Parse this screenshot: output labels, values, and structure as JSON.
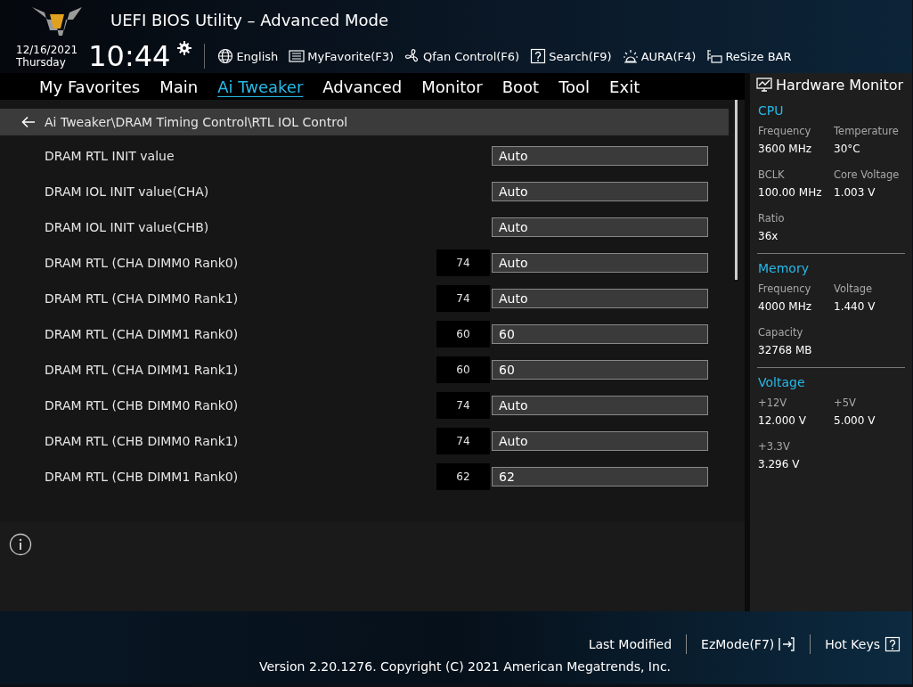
{
  "header": {
    "title": "UEFI BIOS Utility – Advanced Mode",
    "date": "12/16/2021",
    "day": "Thursday",
    "time": "10:44",
    "tools": [
      {
        "kind": "globe",
        "label": "English"
      },
      {
        "kind": "list",
        "label": "MyFavorite(F3)"
      },
      {
        "kind": "fan",
        "label": "Qfan Control(F6)"
      },
      {
        "kind": "question",
        "label": "Search(F9)"
      },
      {
        "kind": "light",
        "label": "AURA(F4)"
      },
      {
        "kind": "card",
        "label": "ReSize BAR"
      }
    ]
  },
  "tabs": [
    {
      "label": "My Favorites",
      "selected": false
    },
    {
      "label": "Main",
      "selected": false
    },
    {
      "label": "Ai Tweaker",
      "selected": true
    },
    {
      "label": "Advanced",
      "selected": false
    },
    {
      "label": "Monitor",
      "selected": false
    },
    {
      "label": "Boot",
      "selected": false
    },
    {
      "label": "Tool",
      "selected": false
    },
    {
      "label": "Exit",
      "selected": false
    }
  ],
  "breadcrumb": "Ai Tweaker\\DRAM Timing Control\\RTL IOL Control",
  "settings": [
    {
      "label": "DRAM RTL INIT value",
      "value": "Auto"
    },
    {
      "label": "DRAM IOL INIT value(CHA)",
      "value": "Auto"
    },
    {
      "label": "DRAM IOL INIT value(CHB)",
      "value": "Auto"
    },
    {
      "label": "DRAM RTL (CHA DIMM0 Rank0)",
      "current": "74",
      "value": "Auto"
    },
    {
      "label": "DRAM RTL (CHA DIMM0 Rank1)",
      "current": "74",
      "value": "Auto"
    },
    {
      "label": "DRAM RTL (CHA DIMM1 Rank0)",
      "current": "60",
      "value": "60"
    },
    {
      "label": "DRAM RTL (CHA DIMM1 Rank1)",
      "current": "60",
      "value": "60"
    },
    {
      "label": "DRAM RTL (CHB DIMM0 Rank0)",
      "current": "74",
      "value": "Auto"
    },
    {
      "label": "DRAM RTL (CHB DIMM0 Rank1)",
      "current": "74",
      "value": "Auto"
    },
    {
      "label": "DRAM RTL (CHB DIMM1 Rank0)",
      "current": "62",
      "value": "62"
    }
  ],
  "hardware_monitor": {
    "title": "Hardware Monitor",
    "sections": [
      {
        "title": "CPU",
        "items": [
          {
            "label": "Frequency",
            "value": "3600 MHz"
          },
          {
            "label": "Temperature",
            "value": "30°C"
          },
          {
            "label": "BCLK",
            "value": "100.00 MHz"
          },
          {
            "label": "Core Voltage",
            "value": "1.003 V"
          },
          {
            "label": "Ratio",
            "value": "36x"
          }
        ]
      },
      {
        "title": "Memory",
        "items": [
          {
            "label": "Frequency",
            "value": "4000 MHz"
          },
          {
            "label": "Voltage",
            "value": "1.440 V"
          },
          {
            "label": "Capacity",
            "value": "32768 MB"
          }
        ]
      },
      {
        "title": "Voltage",
        "items": [
          {
            "label": "+12V",
            "value": "12.000 V"
          },
          {
            "label": "+5V",
            "value": "5.000 V"
          },
          {
            "label": "+3.3V",
            "value": "3.296 V"
          }
        ]
      }
    ]
  },
  "footer": {
    "links": [
      {
        "label": "Last Modified",
        "kind": "plain"
      },
      {
        "label": "EzMode(F7)",
        "kind": "exit"
      },
      {
        "label": "Hot Keys",
        "kind": "question"
      }
    ],
    "copyright": "Version 2.20.1276. Copyright (C) 2021 American Megatrends, Inc."
  }
}
